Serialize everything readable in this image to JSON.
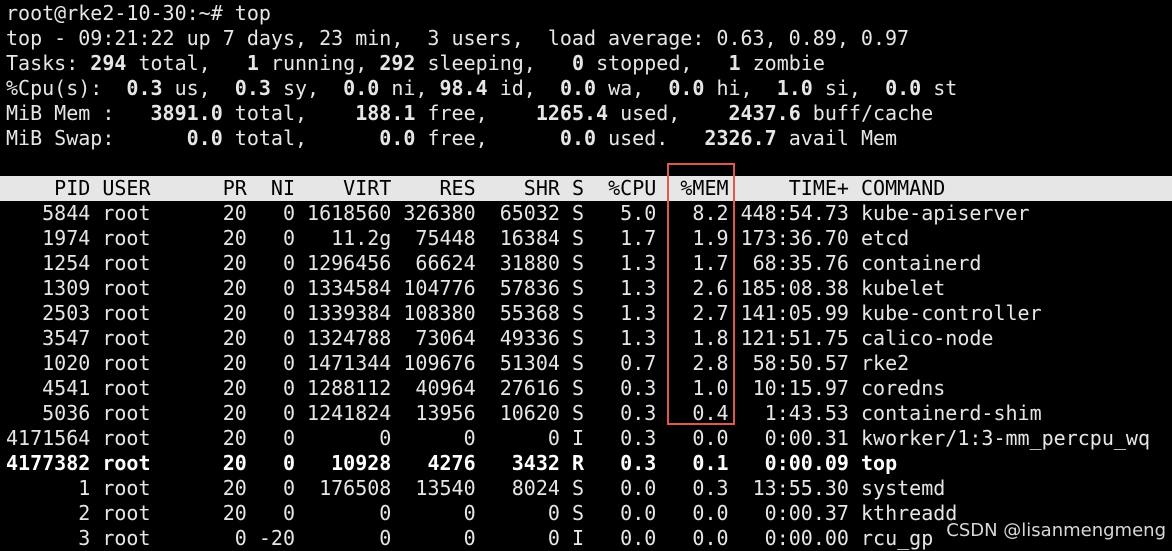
{
  "prompt_line": "root@rke2-10-30:~# top",
  "summary": {
    "uptime": "top - 09:21:22 up 7 days, 23 min,  3 users,  load average: 0.63, 0.89, 0.97",
    "tasks": [
      {
        "t": "Tasks: ",
        "b": false
      },
      {
        "t": "294",
        "b": true
      },
      {
        "t": " total,   ",
        "b": false
      },
      {
        "t": "1",
        "b": true
      },
      {
        "t": " running, ",
        "b": false
      },
      {
        "t": "292",
        "b": true
      },
      {
        "t": " sleeping,   ",
        "b": false
      },
      {
        "t": "0",
        "b": true
      },
      {
        "t": " stopped,   ",
        "b": false
      },
      {
        "t": "1",
        "b": true
      },
      {
        "t": " zombie",
        "b": false
      }
    ],
    "cpu": [
      {
        "t": "%Cpu(s):  ",
        "b": false
      },
      {
        "t": "0.3",
        "b": true
      },
      {
        "t": " us,  ",
        "b": false
      },
      {
        "t": "0.3",
        "b": true
      },
      {
        "t": " sy,  ",
        "b": false
      },
      {
        "t": "0.0",
        "b": true
      },
      {
        "t": " ni, ",
        "b": false
      },
      {
        "t": "98.4",
        "b": true
      },
      {
        "t": " id,  ",
        "b": false
      },
      {
        "t": "0.0",
        "b": true
      },
      {
        "t": " wa,  ",
        "b": false
      },
      {
        "t": "0.0",
        "b": true
      },
      {
        "t": " hi,  ",
        "b": false
      },
      {
        "t": "1.0",
        "b": true
      },
      {
        "t": " si,  ",
        "b": false
      },
      {
        "t": "0.0",
        "b": true
      },
      {
        "t": " st",
        "b": false
      }
    ],
    "mem": [
      {
        "t": "MiB Mem :   ",
        "b": false
      },
      {
        "t": "3891.0",
        "b": true
      },
      {
        "t": " total,    ",
        "b": false
      },
      {
        "t": "188.1",
        "b": true
      },
      {
        "t": " free,    ",
        "b": false
      },
      {
        "t": "1265.4",
        "b": true
      },
      {
        "t": " used,    ",
        "b": false
      },
      {
        "t": "2437.6",
        "b": true
      },
      {
        "t": " buff/cache",
        "b": false
      }
    ],
    "swap": [
      {
        "t": "MiB Swap:      ",
        "b": false
      },
      {
        "t": "0.0",
        "b": true
      },
      {
        "t": " total,      ",
        "b": false
      },
      {
        "t": "0.0",
        "b": true
      },
      {
        "t": " free,      ",
        "b": false
      },
      {
        "t": "0.0",
        "b": true
      },
      {
        "t": " used.   ",
        "b": false
      },
      {
        "t": "2326.7",
        "b": true
      },
      {
        "t": " avail Mem",
        "b": false
      }
    ]
  },
  "table": {
    "columns": [
      "PID",
      "USER",
      "PR",
      "NI",
      "VIRT",
      "RES",
      "SHR",
      "S",
      "%CPU",
      "%MEM",
      "TIME+",
      "COMMAND"
    ],
    "rows": [
      {
        "pid": "5844",
        "user": "root",
        "pr": "20",
        "ni": "0",
        "virt": "1618560",
        "res": "326380",
        "shr": "65032",
        "s": "S",
        "cpu": "5.0",
        "mem": "8.2",
        "time": "448:54.73",
        "cmd": "kube-apiserver",
        "bold": false
      },
      {
        "pid": "1974",
        "user": "root",
        "pr": "20",
        "ni": "0",
        "virt": "11.2g",
        "res": "75448",
        "shr": "16384",
        "s": "S",
        "cpu": "1.7",
        "mem": "1.9",
        "time": "173:36.70",
        "cmd": "etcd",
        "bold": false
      },
      {
        "pid": "1254",
        "user": "root",
        "pr": "20",
        "ni": "0",
        "virt": "1296456",
        "res": "66624",
        "shr": "31880",
        "s": "S",
        "cpu": "1.3",
        "mem": "1.7",
        "time": "68:35.76",
        "cmd": "containerd",
        "bold": false
      },
      {
        "pid": "1309",
        "user": "root",
        "pr": "20",
        "ni": "0",
        "virt": "1334584",
        "res": "104776",
        "shr": "57836",
        "s": "S",
        "cpu": "1.3",
        "mem": "2.6",
        "time": "185:08.38",
        "cmd": "kubelet",
        "bold": false
      },
      {
        "pid": "2503",
        "user": "root",
        "pr": "20",
        "ni": "0",
        "virt": "1339384",
        "res": "108380",
        "shr": "55368",
        "s": "S",
        "cpu": "1.3",
        "mem": "2.7",
        "time": "141:05.99",
        "cmd": "kube-controller",
        "bold": false
      },
      {
        "pid": "3547",
        "user": "root",
        "pr": "20",
        "ni": "0",
        "virt": "1324788",
        "res": "73064",
        "shr": "49336",
        "s": "S",
        "cpu": "1.3",
        "mem": "1.8",
        "time": "121:51.75",
        "cmd": "calico-node",
        "bold": false
      },
      {
        "pid": "1020",
        "user": "root",
        "pr": "20",
        "ni": "0",
        "virt": "1471344",
        "res": "109676",
        "shr": "51304",
        "s": "S",
        "cpu": "0.7",
        "mem": "2.8",
        "time": "58:50.57",
        "cmd": "rke2",
        "bold": false
      },
      {
        "pid": "4541",
        "user": "root",
        "pr": "20",
        "ni": "0",
        "virt": "1288112",
        "res": "40964",
        "shr": "27616",
        "s": "S",
        "cpu": "0.3",
        "mem": "1.0",
        "time": "10:15.97",
        "cmd": "coredns",
        "bold": false
      },
      {
        "pid": "5036",
        "user": "root",
        "pr": "20",
        "ni": "0",
        "virt": "1241824",
        "res": "13956",
        "shr": "10620",
        "s": "S",
        "cpu": "0.3",
        "mem": "0.4",
        "time": "1:43.53",
        "cmd": "containerd-shim",
        "bold": false
      },
      {
        "pid": "4171564",
        "user": "root",
        "pr": "20",
        "ni": "0",
        "virt": "0",
        "res": "0",
        "shr": "0",
        "s": "I",
        "cpu": "0.3",
        "mem": "0.0",
        "time": "0:00.31",
        "cmd": "kworker/1:3-mm_percpu_wq",
        "bold": false
      },
      {
        "pid": "4177382",
        "user": "root",
        "pr": "20",
        "ni": "0",
        "virt": "10928",
        "res": "4276",
        "shr": "3432",
        "s": "R",
        "cpu": "0.3",
        "mem": "0.1",
        "time": "0:00.09",
        "cmd": "top",
        "bold": true
      },
      {
        "pid": "1",
        "user": "root",
        "pr": "20",
        "ni": "0",
        "virt": "176508",
        "res": "13540",
        "shr": "8024",
        "s": "S",
        "cpu": "0.0",
        "mem": "0.3",
        "time": "13:55.30",
        "cmd": "systemd",
        "bold": false
      },
      {
        "pid": "2",
        "user": "root",
        "pr": "20",
        "ni": "0",
        "virt": "0",
        "res": "0",
        "shr": "0",
        "s": "S",
        "cpu": "0.0",
        "mem": "0.0",
        "time": "0:00.37",
        "cmd": "kthreadd",
        "bold": false
      },
      {
        "pid": "3",
        "user": "root",
        "pr": "0",
        "ni": "-20",
        "virt": "0",
        "res": "0",
        "shr": "0",
        "s": "I",
        "cpu": "0.0",
        "mem": "0.0",
        "time": "0:00.00",
        "cmd": "rcu_gp",
        "bold": false
      }
    ]
  },
  "highlight_color": "#e2574c",
  "watermark": "CSDN @lisanmengmeng"
}
